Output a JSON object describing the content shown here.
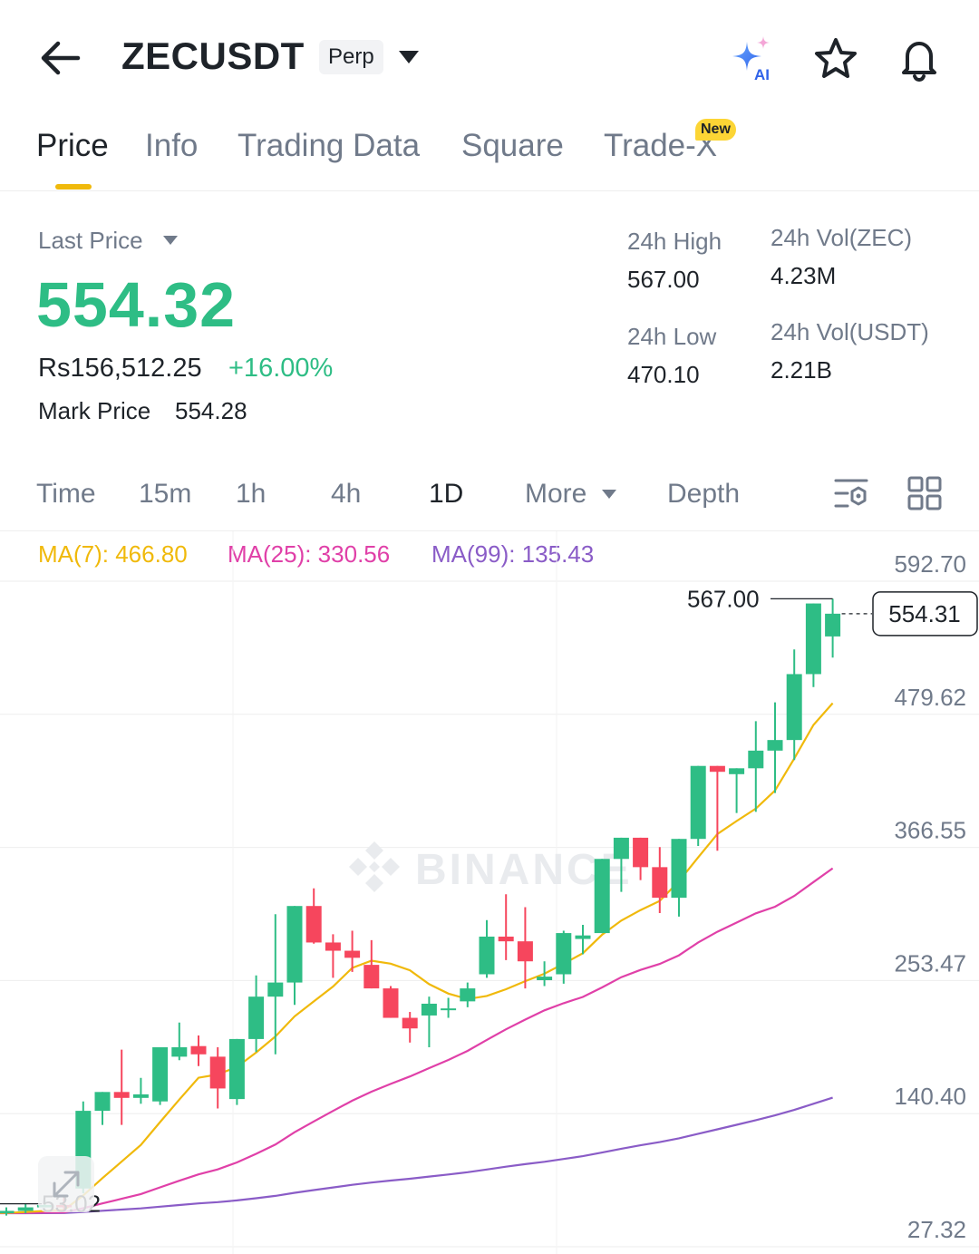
{
  "header": {
    "symbol": "ZECUSDT",
    "contract_type": "Perp",
    "icons": [
      "back-arrow-icon",
      "caret-down-icon",
      "ai-sparkle-icon",
      "star-icon",
      "bell-icon"
    ],
    "ai_label": "AI"
  },
  "tabs": [
    {
      "label": "Price",
      "active": true
    },
    {
      "label": "Info",
      "active": false
    },
    {
      "label": "Trading Data",
      "active": false
    },
    {
      "label": "Square",
      "active": false
    },
    {
      "label": "Trade-X",
      "active": false,
      "badge": "New"
    }
  ],
  "price": {
    "last_price_label": "Last Price",
    "last_price": "554.32",
    "fiat_value": "Rs156,512.25",
    "change_pct": "+16.00%",
    "mark_price_label": "Mark Price",
    "mark_price": "554.28"
  },
  "stats": {
    "high_label": "24h High",
    "high": "567.00",
    "low_label": "24h Low",
    "low": "470.10",
    "vol_base_label": "24h Vol(ZEC)",
    "vol_base": "4.23M",
    "vol_quote_label": "24h Vol(USDT)",
    "vol_quote": "2.21B"
  },
  "intervals": [
    {
      "label": "Time",
      "active": false
    },
    {
      "label": "15m",
      "active": false
    },
    {
      "label": "1h",
      "active": false
    },
    {
      "label": "4h",
      "active": false
    },
    {
      "label": "1D",
      "active": true
    },
    {
      "label": "More",
      "active": false
    },
    {
      "label": "Depth",
      "active": false
    }
  ],
  "ma_legend": [
    {
      "label": "MA(7): 466.80",
      "color": "#f0b90b"
    },
    {
      "label": "MA(25): 330.56",
      "color": "#e040a8"
    },
    {
      "label": "MA(99): 135.43",
      "color": "#8a5cc7"
    }
  ],
  "colors": {
    "up": "#2ebd85",
    "down": "#f6465d",
    "accent": "#f0b90b"
  },
  "chart_data": {
    "type": "candlestick",
    "watermark": "BINANCE",
    "y_ticks": [
      "592.70",
      "479.62",
      "366.55",
      "253.47",
      "140.40",
      "27.32"
    ],
    "y_tick_values": [
      592.7,
      479.62,
      366.55,
      253.47,
      140.4,
      27.32
    ],
    "ylim": [
      27.32,
      592.7
    ],
    "grid": true,
    "high_marker": "567.00",
    "high_value": 567.0,
    "low_marker": "53.02",
    "low_value": 53.02,
    "current_price_label": "554.31",
    "current_price": 554.31,
    "candles": [
      {
        "o": 45,
        "h": 50,
        "l": 43,
        "c": 47
      },
      {
        "o": 47,
        "h": 53,
        "l": 45,
        "c": 50
      },
      {
        "o": 50,
        "h": 56,
        "l": 53.02,
        "c": 52
      },
      {
        "o": 52,
        "h": 60,
        "l": 48,
        "c": 50
      },
      {
        "o": 66,
        "h": 140,
        "l": 62,
        "c": 132
      },
      {
        "o": 132,
        "h": 140,
        "l": 120,
        "c": 148
      },
      {
        "o": 148,
        "h": 184,
        "l": 120,
        "c": 143
      },
      {
        "o": 143,
        "h": 160,
        "l": 138,
        "c": 146
      },
      {
        "o": 140,
        "h": 182,
        "l": 137,
        "c": 186
      },
      {
        "o": 178,
        "h": 207,
        "l": 175,
        "c": 186
      },
      {
        "o": 187,
        "h": 196,
        "l": 170,
        "c": 180
      },
      {
        "o": 178,
        "h": 186,
        "l": 134,
        "c": 151
      },
      {
        "o": 142,
        "h": 184,
        "l": 137,
        "c": 193
      },
      {
        "o": 193,
        "h": 247,
        "l": 182,
        "c": 229
      },
      {
        "o": 229,
        "h": 299,
        "l": 180,
        "c": 241
      },
      {
        "o": 241,
        "h": 295,
        "l": 222,
        "c": 306
      },
      {
        "o": 306,
        "h": 321,
        "l": 274,
        "c": 275
      },
      {
        "o": 275,
        "h": 282,
        "l": 245,
        "c": 268
      },
      {
        "o": 268,
        "h": 285,
        "l": 250,
        "c": 262
      },
      {
        "o": 256,
        "h": 277,
        "l": 243,
        "c": 236
      },
      {
        "o": 236,
        "h": 238,
        "l": 215,
        "c": 211
      },
      {
        "o": 211,
        "h": 216,
        "l": 190,
        "c": 202
      },
      {
        "o": 213,
        "h": 229,
        "l": 186,
        "c": 223
      },
      {
        "o": 219,
        "h": 228,
        "l": 211,
        "c": 219
      },
      {
        "o": 225,
        "h": 241,
        "l": 220,
        "c": 236
      },
      {
        "o": 248,
        "h": 294,
        "l": 245,
        "c": 280
      },
      {
        "o": 280,
        "h": 316,
        "l": 260,
        "c": 276
      },
      {
        "o": 276,
        "h": 305,
        "l": 236,
        "c": 259
      },
      {
        "o": 243,
        "h": 259,
        "l": 238,
        "c": 246
      },
      {
        "o": 248,
        "h": 285,
        "l": 240,
        "c": 283
      },
      {
        "o": 278,
        "h": 290,
        "l": 265,
        "c": 281
      },
      {
        "o": 283,
        "h": 343,
        "l": 283,
        "c": 346
      },
      {
        "o": 346,
        "h": 352,
        "l": 318,
        "c": 364
      },
      {
        "o": 364,
        "h": 352,
        "l": 328,
        "c": 339
      },
      {
        "o": 339,
        "h": 356,
        "l": 300,
        "c": 313
      },
      {
        "o": 313,
        "h": 360,
        "l": 297,
        "c": 363
      },
      {
        "o": 363,
        "h": 398,
        "l": 357,
        "c": 425
      },
      {
        "o": 425,
        "h": 420,
        "l": 353,
        "c": 420
      },
      {
        "o": 418,
        "h": 412,
        "l": 385,
        "c": 423
      },
      {
        "o": 423,
        "h": 463,
        "l": 386,
        "c": 438
      },
      {
        "o": 438,
        "h": 479,
        "l": 402,
        "c": 447
      },
      {
        "o": 447,
        "h": 524,
        "l": 430,
        "c": 503
      },
      {
        "o": 503,
        "h": 557,
        "l": 492,
        "c": 563
      },
      {
        "o": 535,
        "h": 567,
        "l": 517,
        "c": 554.31
      }
    ]
  }
}
